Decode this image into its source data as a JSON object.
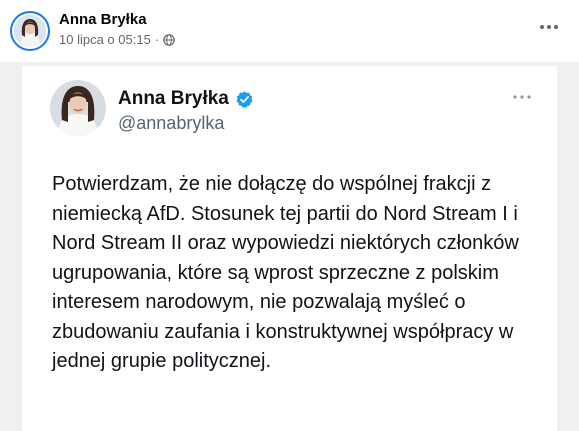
{
  "post": {
    "author": "Anna Bryłka",
    "timestamp": "10 lipca o 05:15",
    "separator": "·",
    "audience_icon": "globe-icon",
    "more_icon": "more-dots-icon"
  },
  "tweet": {
    "name": "Anna Bryłka",
    "handle": "@annabrylka",
    "verified_icon": "verified-badge-icon",
    "verified_color": "#1d9bf0",
    "more_icon": "more-dots-icon",
    "text": "Potwierdzam, że nie dołączę do wspólnej frakcji z niemiecką AfD. Stosunek tej partii do Nord Stream I i Nord Stream II oraz wypowiedzi niektórych członków ugrupowania, które są wprost sprzeczne z polskim interesem narodowym, nie pozwalają myśleć o zbudowaniu zaufania i konstruktywnej współpracy w jednej grupie politycznej."
  },
  "colors": {
    "facebook_blue": "#1877f2",
    "meta_gray": "#65676b",
    "card_background": "#f0f0f0"
  }
}
